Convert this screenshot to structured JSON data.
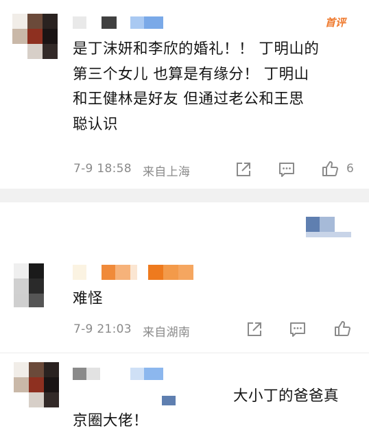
{
  "comments": [
    {
      "badge": "首评",
      "text": "是丁沫妍和李欣的婚礼！！丁明山的第三个女儿 也算是有缘分！丁明山和王健林是好友 但通过老公和王思聪认识",
      "lines": [
        "是丁沫妍和李欣的婚礼！！ 丁明山的",
        "第三个女儿 也算是有缘分！ 丁明山",
        "和王健林是好友 但通过老公和王思",
        "聪认识"
      ],
      "time": "7-9 18:58",
      "location": "来自上海",
      "likes": "6",
      "icons": [
        "share-icon",
        "comment-icon",
        "like-icon"
      ]
    },
    {
      "text": "难怪",
      "time": "7-9 21:03",
      "location": "来自湖南",
      "icons": [
        "share-icon",
        "comment-icon",
        "like-icon"
      ]
    },
    {
      "lines": [
        "大小丁的爸爸真",
        "京圈大佬！"
      ],
      "text": "大小丁的爸爸真京圈大佬！"
    }
  ]
}
